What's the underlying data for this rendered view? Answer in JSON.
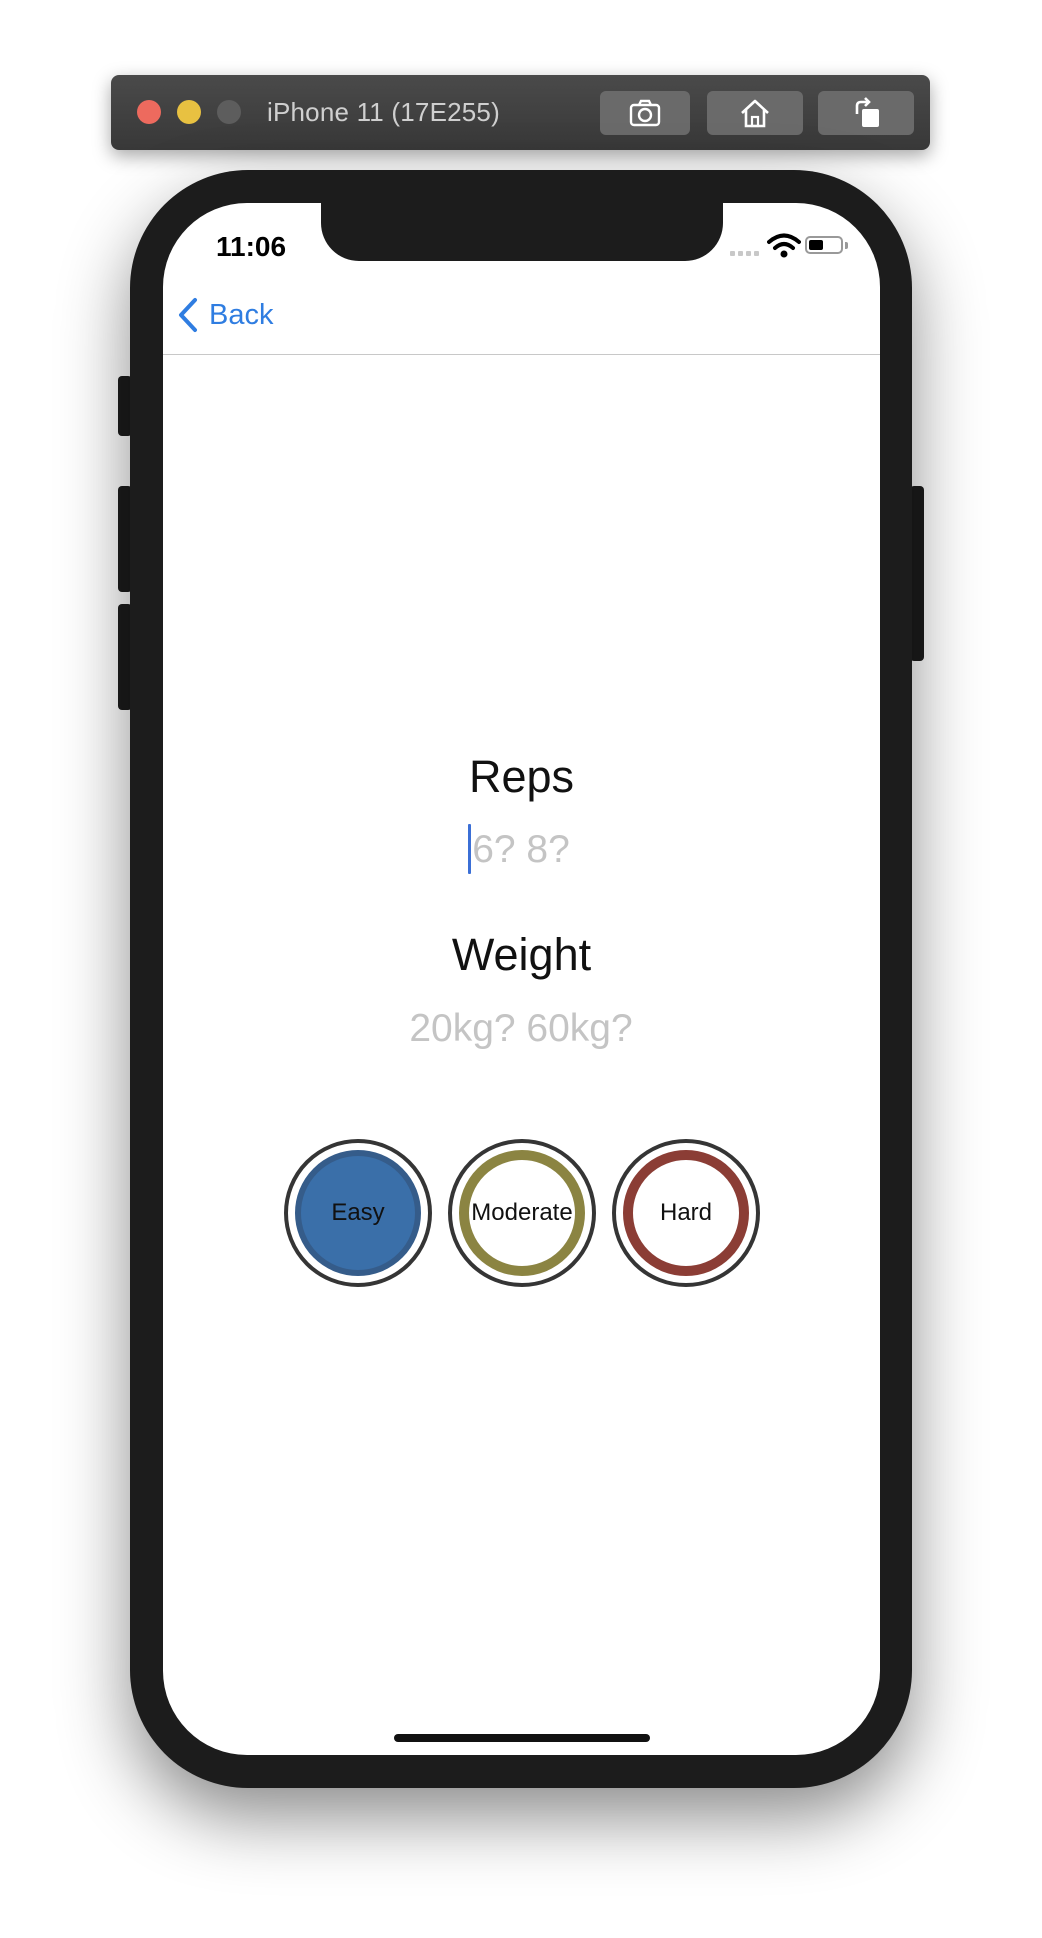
{
  "simulator": {
    "title": "iPhone 11 (17E255)",
    "buttons": [
      "camera-icon",
      "home-icon",
      "rotate-icon"
    ]
  },
  "status_bar": {
    "time": "11:06",
    "battery_level": 0.45
  },
  "nav": {
    "back_label": "Back",
    "accent_color": "#2f7de1"
  },
  "form": {
    "reps_label": "Reps",
    "reps_placeholder": "6? 8?",
    "reps_value": "",
    "weight_label": "Weight",
    "weight_placeholder": "20kg? 60kg?",
    "weight_value": ""
  },
  "difficulty": {
    "options": [
      {
        "label": "Easy",
        "color": "#3a6fa9",
        "selected": true
      },
      {
        "label": "Moderate",
        "color": "#8b8442",
        "selected": false
      },
      {
        "label": "Hard",
        "color": "#8b3d35",
        "selected": false
      }
    ]
  }
}
